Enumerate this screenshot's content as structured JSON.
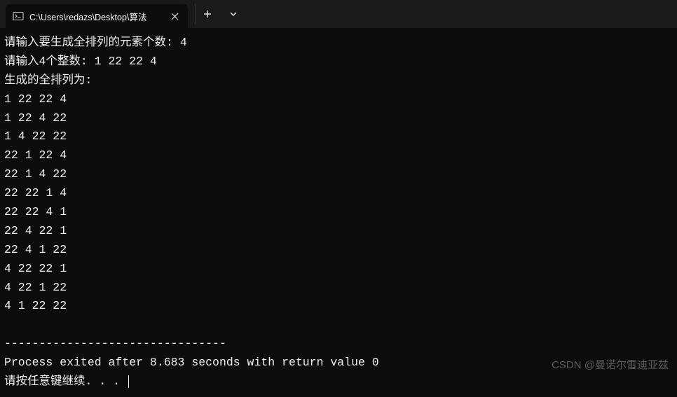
{
  "tab": {
    "title": "C:\\Users\\redazs\\Desktop\\算法"
  },
  "terminal": {
    "prompt1_label": "请输入要生成全排列的元素个数: ",
    "prompt1_value": "4",
    "prompt2_label": "请输入4个整数: ",
    "prompt2_value": "1 22 22 4",
    "header": "生成的全排列为:",
    "permutations": [
      "1 22 22 4",
      "1 22 4 22",
      "1 4 22 22",
      "22 1 22 4",
      "22 1 4 22",
      "22 22 1 4",
      "22 22 4 1",
      "22 4 22 1",
      "22 4 1 22",
      "4 22 22 1",
      "4 22 1 22",
      "4 1 22 22"
    ],
    "separator": "--------------------------------",
    "exit_message": "Process exited after 8.683 seconds with return value 0",
    "press_key": "请按任意键继续. . . "
  },
  "watermark": "CSDN @曼诺尔雷迪亚兹"
}
